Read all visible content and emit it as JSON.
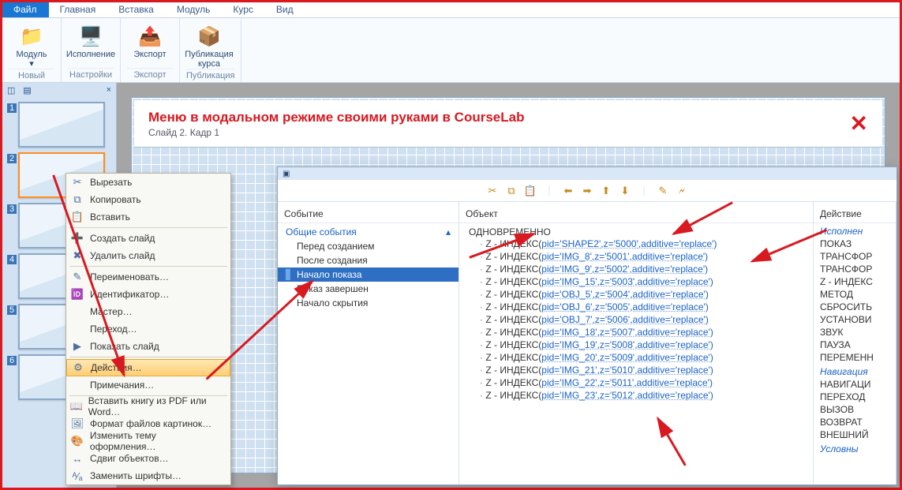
{
  "tabs": {
    "items": [
      "Файл",
      "Главная",
      "Вставка",
      "Модуль",
      "Курс",
      "Вид"
    ],
    "active": 0
  },
  "ribbon": {
    "groups": [
      {
        "label": "Новый",
        "buttons": [
          {
            "name": "module-button",
            "label": "Модуль\n▾",
            "icon": "📁"
          }
        ]
      },
      {
        "label": "Настройки",
        "buttons": [
          {
            "name": "execution-button",
            "label": "Исполнение",
            "icon": "🖥️"
          }
        ]
      },
      {
        "label": "Экспорт",
        "buttons": [
          {
            "name": "export-button",
            "label": "Экспорт",
            "icon": "📤"
          }
        ]
      },
      {
        "label": "Публикация",
        "buttons": [
          {
            "name": "publish-button",
            "label": "Публикация\nкурса",
            "icon": "📦"
          }
        ]
      }
    ]
  },
  "slide_panel": {
    "tabs": [
      "◫",
      "▤"
    ],
    "close": "×",
    "thumbs": [
      1,
      2,
      3,
      4,
      5,
      6
    ],
    "selected": 2
  },
  "canvas": {
    "title": "Меню в модальном режиме своими руками в CourseLab",
    "subtitle": "Слайд 2. Кадр 1",
    "close": "✕"
  },
  "context_menu": {
    "groups": [
      [
        {
          "icon": "✂",
          "label": "Вырезать",
          "name": "ctx-cut"
        },
        {
          "icon": "⧉",
          "label": "Копировать",
          "name": "ctx-copy"
        },
        {
          "icon": "📋",
          "label": "Вставить",
          "name": "ctx-paste"
        }
      ],
      [
        {
          "icon": "➕",
          "label": "Создать слайд",
          "name": "ctx-new-slide"
        },
        {
          "icon": "✖",
          "label": "Удалить слайд",
          "name": "ctx-delete-slide"
        }
      ],
      [
        {
          "icon": "✎",
          "label": "Переименовать…",
          "name": "ctx-rename"
        },
        {
          "icon": "🆔",
          "label": "Идентификатор…",
          "name": "ctx-identifier"
        },
        {
          "icon": "",
          "label": "Мастер…",
          "name": "ctx-master"
        },
        {
          "icon": "",
          "label": "Переход…",
          "name": "ctx-transition"
        },
        {
          "icon": "▶",
          "label": "Показать слайд",
          "name": "ctx-show-slide"
        }
      ],
      [
        {
          "icon": "⚙",
          "label": "Действия…",
          "name": "ctx-actions",
          "selected": true
        },
        {
          "icon": "",
          "label": "Примечания…",
          "name": "ctx-notes"
        }
      ],
      [
        {
          "icon": "📖",
          "label": "Вставить книгу из PDF или Word…",
          "name": "ctx-insert-book"
        },
        {
          "icon": "🖼",
          "label": "Формат файлов картинок…",
          "name": "ctx-img-format"
        },
        {
          "icon": "🎨",
          "label": "Изменить тему оформления…",
          "name": "ctx-theme"
        },
        {
          "icon": "↔",
          "label": "Сдвиг объектов…",
          "name": "ctx-shift"
        },
        {
          "icon": "ᴬ⁄ₐ",
          "label": "Заменить шрифты…",
          "name": "ctx-fonts"
        }
      ]
    ]
  },
  "actions_dialog": {
    "toolbar_icons": [
      "✂",
      "⧉",
      "📋",
      "｜",
      "⬅",
      "➡",
      "⬆",
      "⬇",
      "｜",
      "✎",
      "🗲"
    ],
    "col_event": {
      "header": "Событие",
      "group": "Общие события",
      "items": [
        {
          "label": "Перед созданием"
        },
        {
          "label": "После создания"
        },
        {
          "label": "Начало показа",
          "selected": true
        },
        {
          "label": "Показ завершен"
        },
        {
          "label": "Начало скрытия"
        }
      ]
    },
    "col_object": {
      "header": "Объект",
      "root": "ОДНОВРЕМЕННО",
      "prefix": "Z - ИНДЕКС(",
      "rows": [
        {
          "pid": "SHAPE2",
          "z": "5000"
        },
        {
          "pid": "IMG_8",
          "z": "5001"
        },
        {
          "pid": "IMG_9",
          "z": "5002"
        },
        {
          "pid": "IMG_15",
          "z": "5003"
        },
        {
          "pid": "OBJ_5",
          "z": "5004"
        },
        {
          "pid": "OBJ_6",
          "z": "5005"
        },
        {
          "pid": "OBJ_7",
          "z": "5006"
        },
        {
          "pid": "IMG_18",
          "z": "5007"
        },
        {
          "pid": "IMG_19",
          "z": "5008"
        },
        {
          "pid": "IMG_20",
          "z": "5009"
        },
        {
          "pid": "IMG_21",
          "z": "5010"
        },
        {
          "pid": "IMG_22",
          "z": "5011"
        },
        {
          "pid": "IMG_23",
          "z": "5012"
        }
      ],
      "tail": ",additive='replace')",
      "pid_pre": "pid='",
      "pid_post": "'",
      "z_pre": ",z='",
      "z_post": "'"
    },
    "col_action": {
      "header": "Действие",
      "sections": [
        {
          "title": "Исполнен",
          "items": [
            "ПОКАЗ",
            "ТРАНСФОР",
            "ТРАНСФОР",
            "Z - ИНДЕКС",
            "МЕТОД",
            "СБРОСИТЬ",
            "УСТАНОВИ",
            "ЗВУК",
            "ПАУЗА",
            "ПЕРЕМЕНН"
          ]
        },
        {
          "title": "Навигация",
          "items": [
            "НАВИГАЦИ",
            "ПЕРЕХОД",
            "ВЫЗОВ",
            "ВОЗВРАТ",
            "ВНЕШНИЙ"
          ]
        },
        {
          "title": "Условны",
          "items": []
        }
      ]
    }
  }
}
